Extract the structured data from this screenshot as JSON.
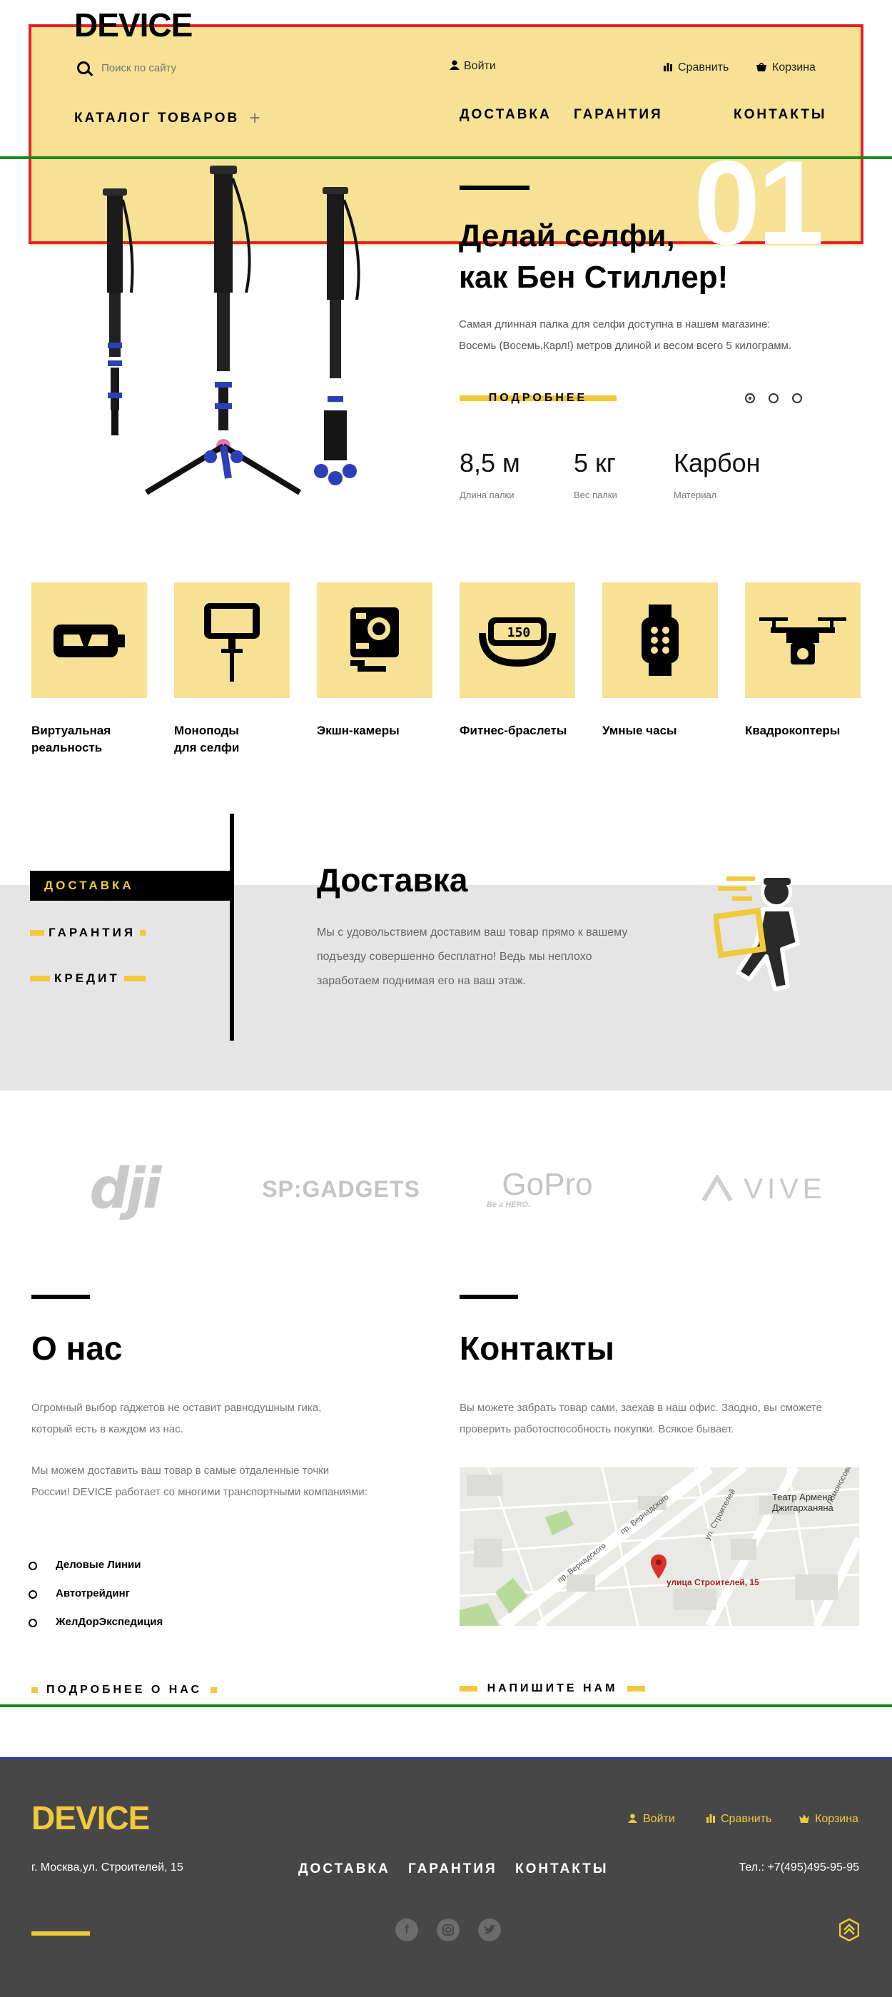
{
  "header": {
    "logo": "DEVICE",
    "search_placeholder": "Поиск по сайту",
    "login": "Войти",
    "compare": "Сравнить",
    "cart": "Корзина",
    "catalog": "КАТАЛОГ ТОВАРОВ",
    "nav": [
      "ДОСТАВКА",
      "ГАРАНТИЯ",
      "КОНТАКТЫ"
    ]
  },
  "hero": {
    "number": "01",
    "title_line1": "Делай селфи,",
    "title_line2": "как Бен Стиллер!",
    "desc_line1": "Самая длинная палка для селфи доступна в нашем магазине:",
    "desc_line2": "Восемь (Восемь,Карл!) метров длиной и весом всего 5 килограмм.",
    "button": "ПОДРОБНЕЕ",
    "stats": [
      {
        "value": "8,5 м",
        "label": "Длина палки"
      },
      {
        "value": "5 кг",
        "label": "Вес палки"
      },
      {
        "value": "Карбон",
        "label": "Материал"
      }
    ]
  },
  "categories": [
    {
      "line1": "Виртуальная",
      "line2": "реальность",
      "icon": "vr-headset-icon"
    },
    {
      "line1": "Моноподы",
      "line2": "для селфи",
      "icon": "selfie-stick-icon"
    },
    {
      "line1": "Экшн-камеры",
      "line2": "",
      "icon": "action-camera-icon"
    },
    {
      "line1": "Фитнес-браслеты",
      "line2": "",
      "icon": "fitness-band-icon",
      "screen_text": "150"
    },
    {
      "line1": "Умные часы",
      "line2": "",
      "icon": "smart-watch-icon"
    },
    {
      "line1": "Квадрокоптеры",
      "line2": "",
      "icon": "drone-icon"
    }
  ],
  "services": {
    "tabs": [
      "ДОСТАВКА",
      "ГАРАНТИЯ",
      "КРЕДИТ"
    ],
    "title": "Доставка",
    "desc_line1": "Мы с удовольствием доставим ваш товар прямо к вашему",
    "desc_line2": "подъезду совершенно бесплатно! Ведь мы неплохо",
    "desc_line3": "заработаем поднимая его на ваш этаж."
  },
  "brands": {
    "dji": "dji",
    "sp": "SP:GADGETS",
    "gopro": "GoPro",
    "gopro_sub": "Be a HERO.",
    "vive": "VIVE"
  },
  "about": {
    "title": "О нас",
    "p1_line1": "Огромный выбор гаджетов не оставит равнодушным гика,",
    "p1_line2": "который есть в каждом из нас.",
    "p2_line1": "Мы можем доставить ваш товар в самые отдаленные точки",
    "p2_line2": "России! DEVICE работает со многими транспортными компаниями:",
    "list": [
      "Деловые Линии",
      "Автотрейдинг",
      "ЖелДорЭкспедиция"
    ],
    "button": "ПОДРОБНЕЕ О НАС"
  },
  "contacts": {
    "title": "Контакты",
    "text_line1": "Вы можете забрать товар сами, заехав в наш офис. Заодно, вы сможете",
    "text_line2": "проверить работоспособность покупки. Всякое бывает.",
    "map_label": "улица Строителей, 15",
    "map_poi_line1": "Театр Армена",
    "map_poi_line2": "Джигарханяна",
    "map_street1": "пр. Вернадского",
    "map_street2": "пр. Вернадского",
    "map_street3": "ул. Строителей",
    "map_street4": "Ломоносовск",
    "button": "НАПИШИТЕ НАМ"
  },
  "footer": {
    "logo": "DEVICE",
    "login": "Войти",
    "compare": "Сравнить",
    "cart": "Корзина",
    "address": "г. Москва,ул. Строителей, 15",
    "nav": [
      "ДОСТАВКА",
      "ГАРАНТИЯ",
      "КОНТАКТЫ"
    ],
    "phone": "Тел.: +7(495)495-95-95",
    "social": [
      "facebook-icon",
      "instagram-icon",
      "twitter-icon"
    ]
  },
  "colors": {
    "accent_yellow": "#f0c93c",
    "hero_bg": "#f6e194",
    "footer_bg": "#474747",
    "band_gray": "#e5e5e5"
  }
}
